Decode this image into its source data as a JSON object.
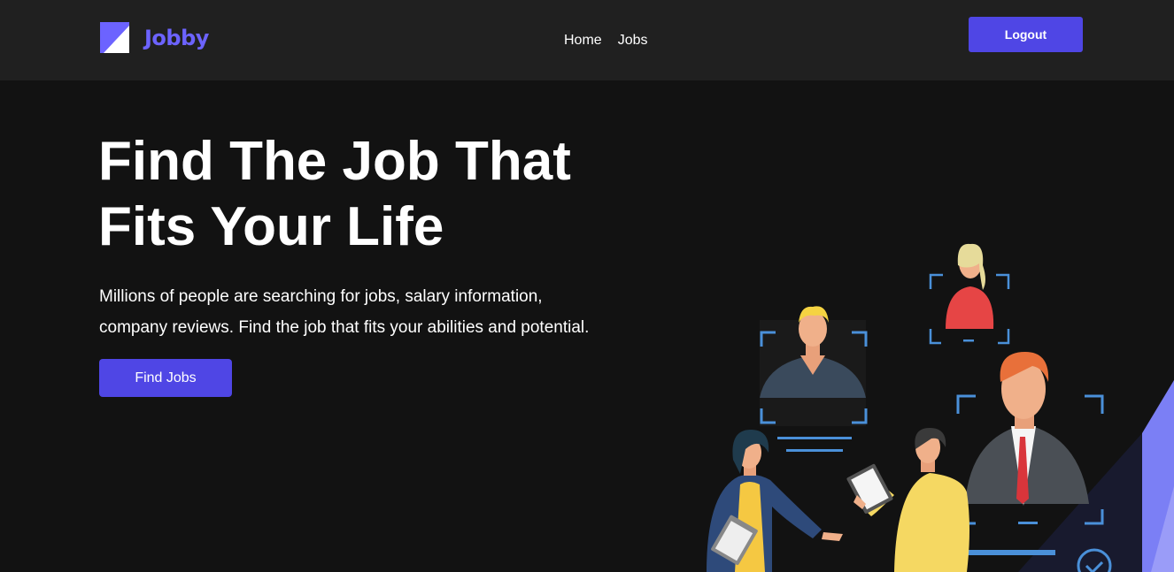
{
  "navbar": {
    "logo_text": "Jobby",
    "links": [
      "Home",
      "Jobs"
    ],
    "logout_label": "Logout"
  },
  "hero": {
    "title_lines": [
      "Find The Job That",
      "Fits Your Life"
    ],
    "description_lines": [
      "Millions of people are searching for jobs, salary information,",
      "company reviews. Find the job that fits your abilities and potential."
    ],
    "cta_label": "Find Jobs"
  },
  "colors": {
    "background": "#121212",
    "navbar": "#202020",
    "accent": "#4f46e5",
    "logo_text": "#6c63ff",
    "frame_blue": "#4a90d9"
  }
}
